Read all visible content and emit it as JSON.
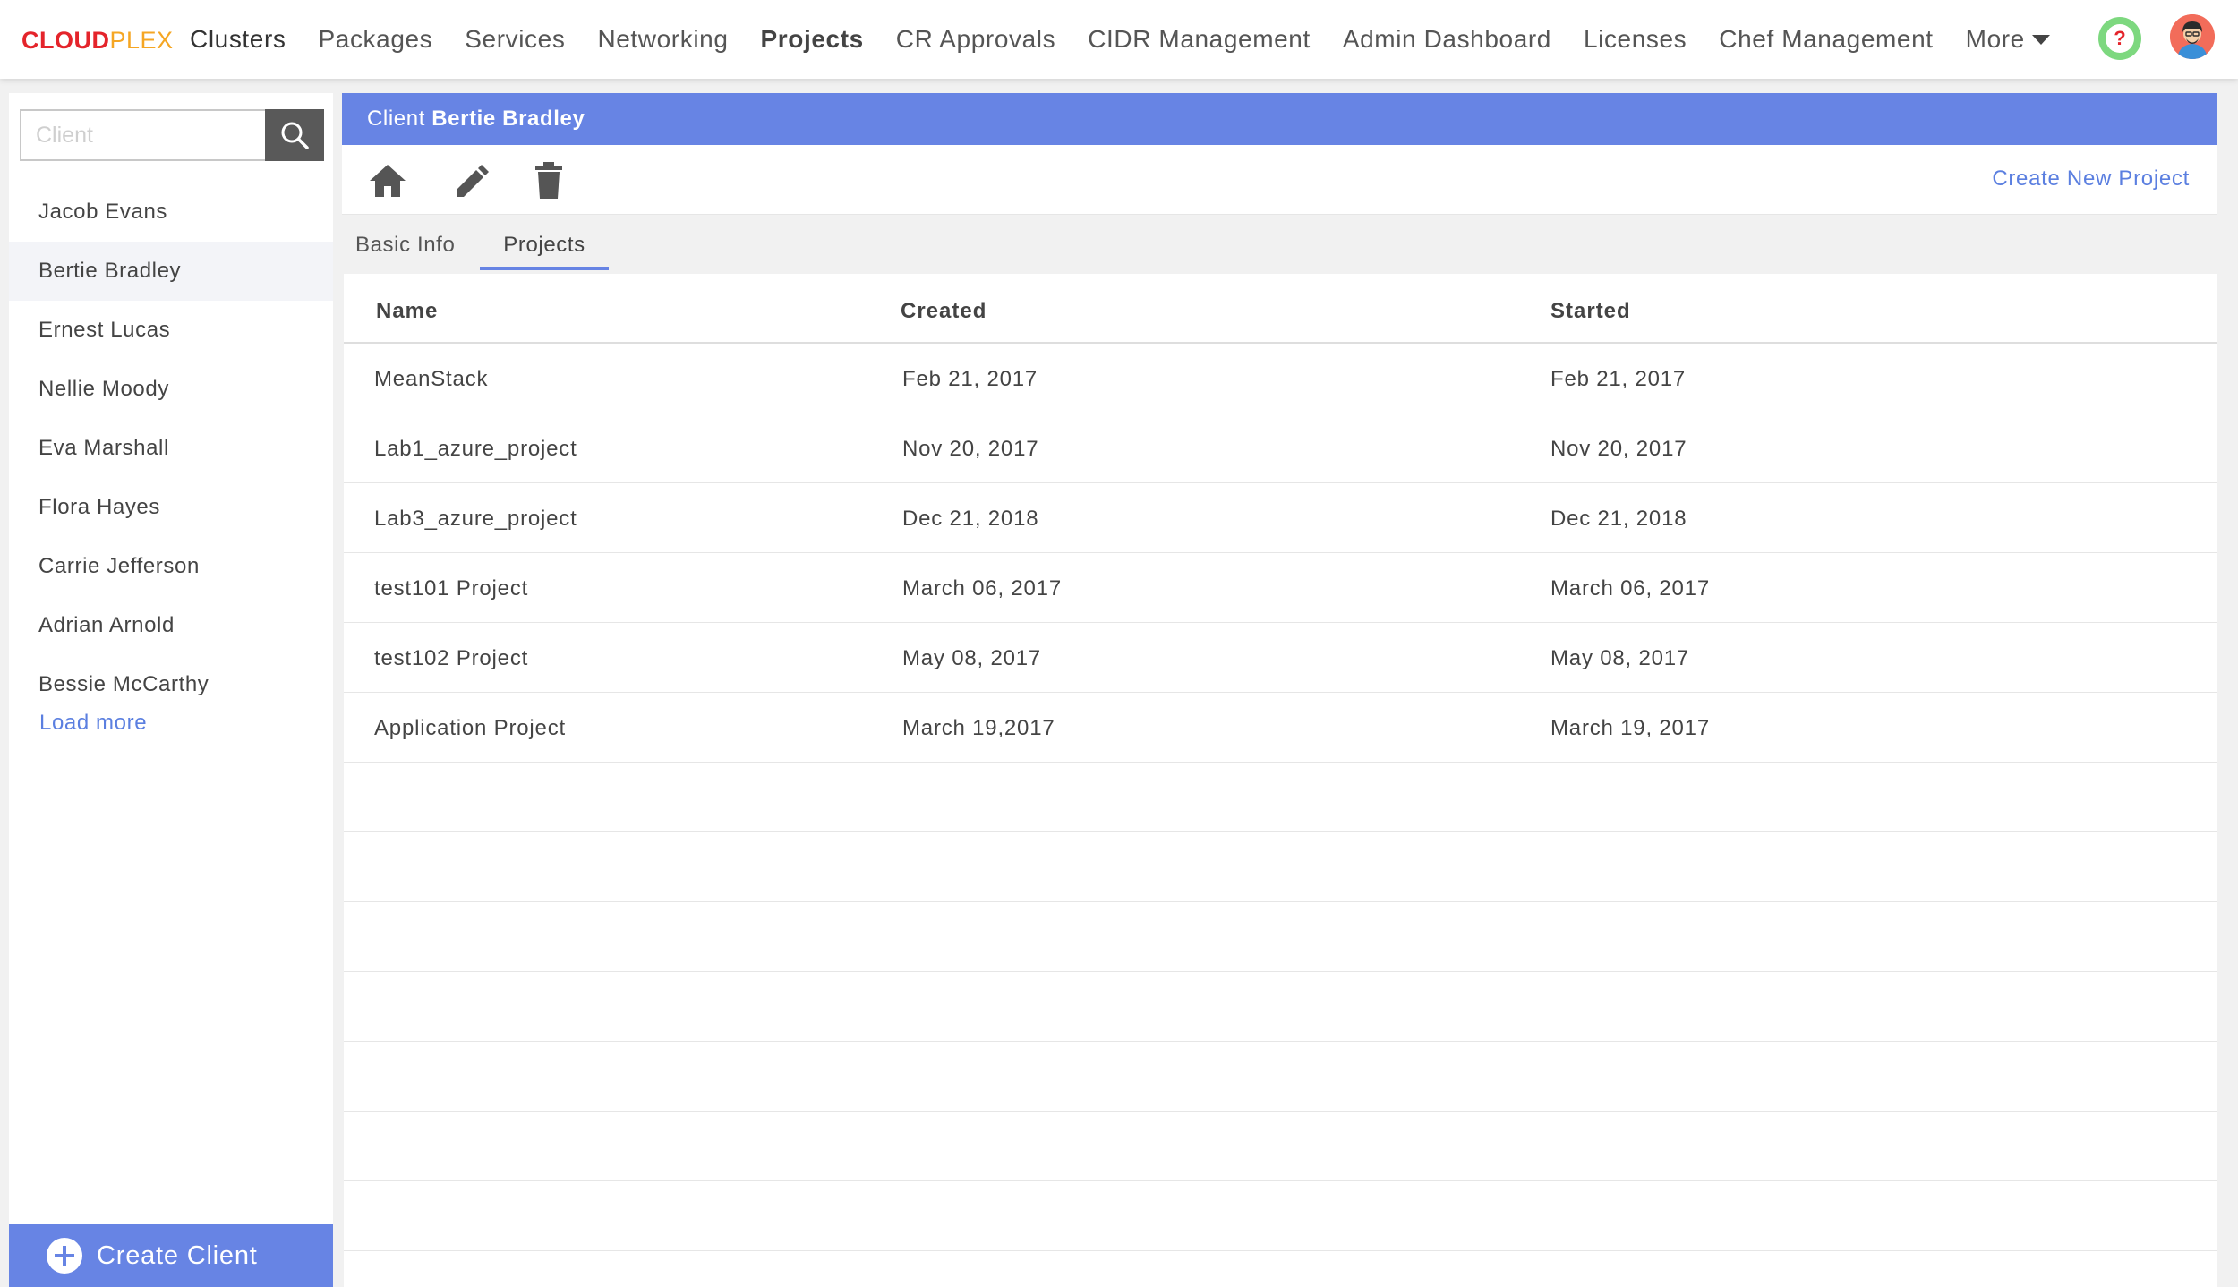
{
  "nav": {
    "logo_part1": "CLOUD",
    "logo_part2": "PLEX",
    "items": [
      {
        "label": "Clusters"
      },
      {
        "label": "Packages"
      },
      {
        "label": "Services"
      },
      {
        "label": "Networking"
      },
      {
        "label": "Projects",
        "active": true
      },
      {
        "label": "CR Approvals"
      },
      {
        "label": "CIDR Management"
      },
      {
        "label": "Admin Dashboard"
      },
      {
        "label": "Licenses"
      },
      {
        "label": "Chef Management"
      }
    ],
    "more_label": "More",
    "help_symbol": "?",
    "icons": {
      "help": "help-icon",
      "avatar": "user-avatar",
      "more": "caret-down-icon"
    }
  },
  "sidebar": {
    "search_placeholder": "Client",
    "search_icon": "search-icon",
    "clients": [
      "Jacob Evans",
      "Bertie Bradley",
      "Ernest Lucas",
      "Nellie Moody",
      "Eva Marshall",
      "Flora Hayes",
      "Carrie Jefferson",
      "Adrian Arnold",
      "Bessie McCarthy"
    ],
    "selected_client": "Bertie Bradley",
    "load_more": "Load more",
    "create_client": "Create Client"
  },
  "main": {
    "header_prefix": "Client",
    "header_client": "Bertie Bradley",
    "toolbar_icons": [
      "home-icon",
      "edit-icon",
      "delete-icon"
    ],
    "create_project": "Create New Project",
    "tabs": [
      {
        "label": "Basic Info",
        "active": false
      },
      {
        "label": "Projects",
        "active": true
      }
    ],
    "table": {
      "columns": [
        "Name",
        "Created",
        "Started"
      ],
      "rows": [
        {
          "name": "MeanStack",
          "created": "Feb 21, 2017",
          "started": "Feb 21, 2017"
        },
        {
          "name": "Lab1_azure_project",
          "created": "Nov 20, 2017",
          "started": "Nov 20, 2017"
        },
        {
          "name": "Lab3_azure_project",
          "created": "Dec 21, 2018",
          "started": "Dec 21, 2018"
        },
        {
          "name": "test101 Project",
          "created": "March 06, 2017",
          "started": "March 06, 2017"
        },
        {
          "name": "test102 Project",
          "created": "May 08, 2017",
          "started": "May 08, 2017"
        },
        {
          "name": "Application Project",
          "created": "March 19,2017",
          "started": "March 19, 2017"
        }
      ]
    }
  },
  "colors": {
    "accent": "#6784e4",
    "link": "#5b7fe0",
    "logo_red": "#e4242b",
    "logo_orange": "#f5a623",
    "help_green": "#7dd87f"
  }
}
